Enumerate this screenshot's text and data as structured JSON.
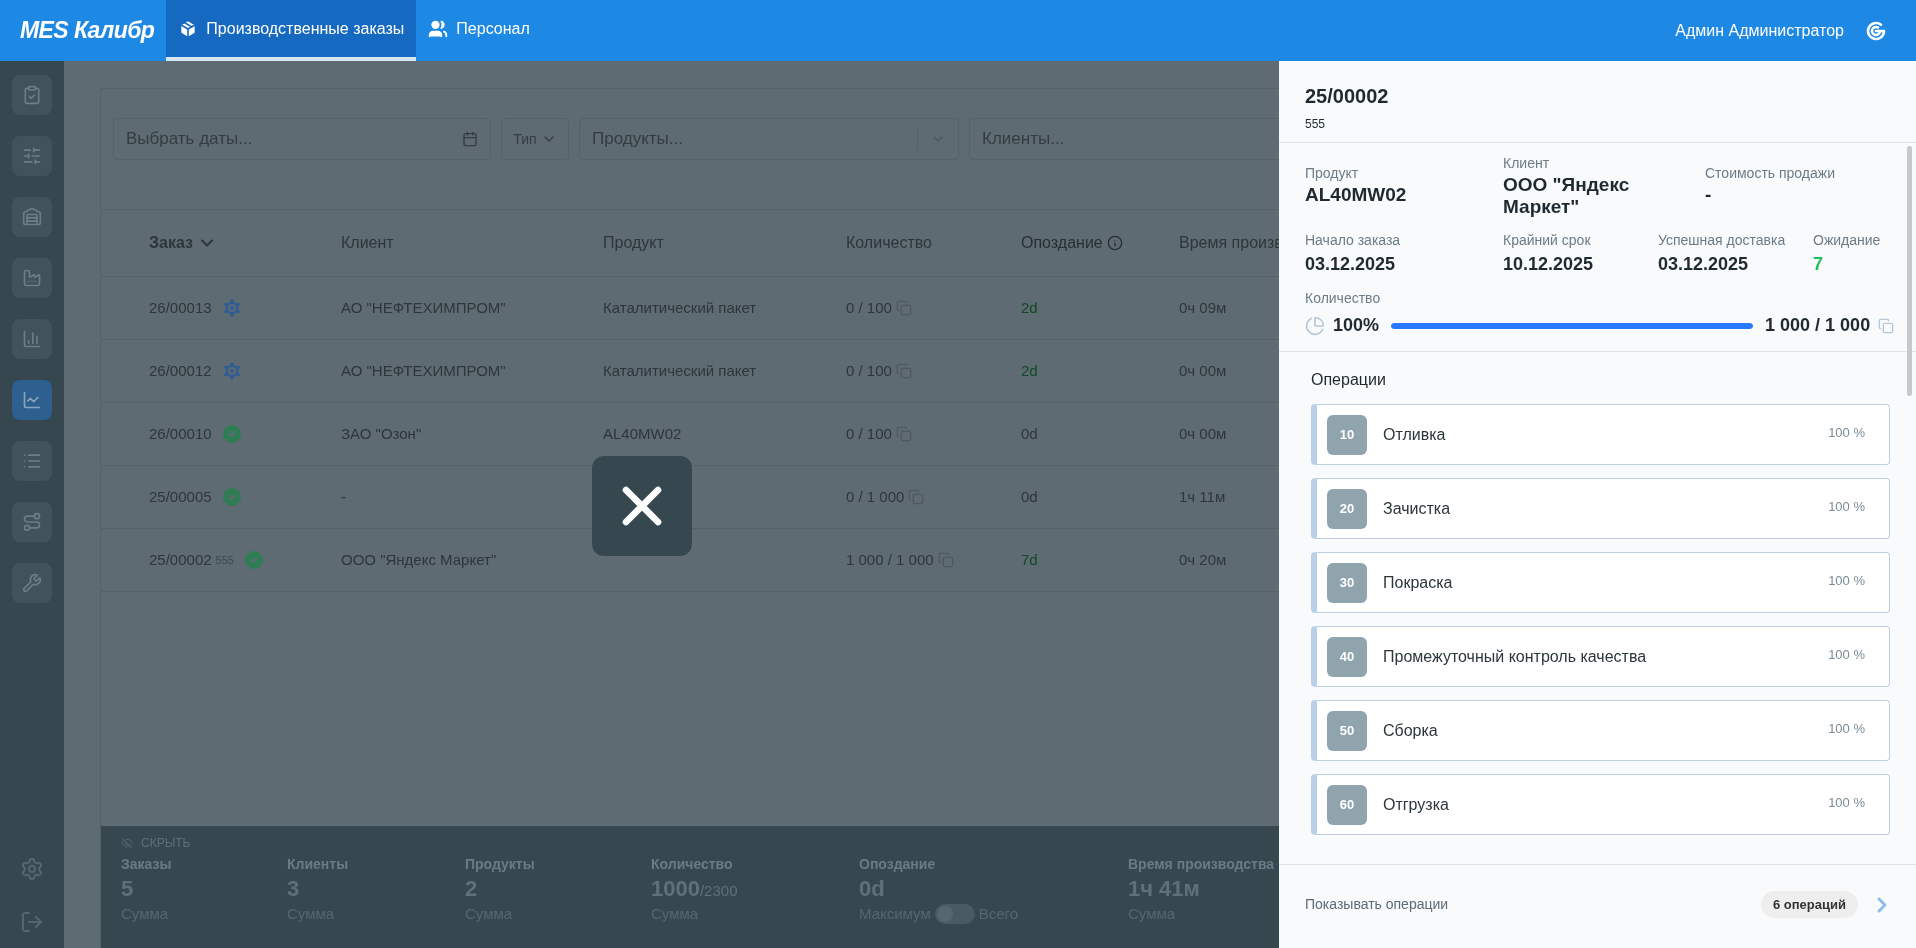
{
  "topbar": {
    "logo": "MES Калибр",
    "nav": [
      {
        "label": "Производственные заказы",
        "kind": "box",
        "selected": true
      },
      {
        "label": "Персонал",
        "kind": "people",
        "selected": false
      }
    ],
    "user": "Админ Администратор"
  },
  "sidebar": {
    "items": [
      {
        "selected": false
      },
      {
        "selected": false
      },
      {
        "selected": false
      },
      {
        "selected": false
      },
      {
        "selected": false
      },
      {
        "selected": true
      },
      {
        "selected": false
      },
      {
        "selected": false
      },
      {
        "selected": false
      }
    ]
  },
  "filters": {
    "dates_placeholder": "Выбрать даты...",
    "type": "Тип",
    "products_placeholder": "Продукты...",
    "clients_placeholder": "Клиенты..."
  },
  "table": {
    "columns": [
      {
        "label": "Заказ",
        "sorted": true,
        "info": false
      },
      {
        "label": "Клиент",
        "sorted": false,
        "info": false
      },
      {
        "label": "Продукт",
        "sorted": false,
        "info": false
      },
      {
        "label": "Количество",
        "sorted": false,
        "info": false
      },
      {
        "label": "Опоздание",
        "sorted": false,
        "info": true
      },
      {
        "label": "Время произв",
        "sorted": false,
        "info": false
      }
    ],
    "rows": [
      {
        "order": "26/00013",
        "kind": "in_progress",
        "client": "АО \"НЕФТЕХИМПРОМ\"",
        "product": "Каталитический пакет",
        "quantity": "0 / 100",
        "delay": "2d",
        "delay_late": true,
        "time": "0ч 09м"
      },
      {
        "order": "26/00012",
        "kind": "in_progress",
        "client": "АО \"НЕФТЕХИМПРОМ\"",
        "product": "Каталитический пакет",
        "quantity": "0 / 100",
        "delay": "2d",
        "delay_late": true,
        "time": "0ч 00м"
      },
      {
        "order": "26/00010",
        "kind": "done",
        "client": "ЗАО \"Озон\"",
        "product": "AL40MW02",
        "quantity": "0 / 100",
        "delay": "0d",
        "delay_late": false,
        "time": "0ч 00м"
      },
      {
        "order": "25/00005",
        "kind": "done",
        "client": "-",
        "quantity": "0 / 1 000",
        "delay": "0d",
        "delay_late": false,
        "time": "1ч 11м"
      },
      {
        "order": "25/00002",
        "note": "555",
        "kind": "done",
        "client": "ООО \"Яндекс Маркет\"",
        "quantity": "1 000 / 1 000",
        "delay": "7d",
        "delay_late": true,
        "time": "0ч 20м"
      }
    ]
  },
  "summary": {
    "hide_label": "СКРЫТЬ",
    "stats": [
      {
        "label": "Заказы",
        "value": "5",
        "sub": "Сумма"
      },
      {
        "label": "Клиенты",
        "value": "3",
        "sub": "Сумма"
      },
      {
        "label": "Продукты",
        "value": "2",
        "sub": "Сумма"
      },
      {
        "label": "Количество",
        "value": "1000",
        "total": "/2300",
        "sub": "Сумма"
      },
      {
        "label": "Опоздание",
        "value": "0d",
        "toggle": {
          "left": "Максимум",
          "right": "Всего",
          "on": false
        }
      },
      {
        "label": "Время производства",
        "value": "1ч 41м",
        "sub": "Сумма"
      }
    ]
  },
  "panel": {
    "order": "25/00002",
    "note": "555",
    "fields_top": [
      {
        "label": "Продукт",
        "value": "AL40MW02"
      },
      {
        "label": "Клиент",
        "value": "ООО \"Яндекс Маркет\""
      },
      {
        "label": "Стоимость продажи",
        "value": "-"
      }
    ],
    "fields_dates": [
      {
        "label": "Начало заказа",
        "value": "03.12.2025",
        "highlight": false
      },
      {
        "label": "Крайний срок",
        "value": "10.12.2025",
        "highlight": false
      },
      {
        "label": "Успешная доставка",
        "value": "03.12.2025",
        "highlight": false
      },
      {
        "label": "Ожидание",
        "value": "7",
        "highlight": true
      }
    ],
    "quantity": {
      "label": "Количество",
      "percent": "100%",
      "level": 1,
      "reading": "1 000 / 1 000"
    },
    "operations_title": "Операции",
    "operations": [
      {
        "number": "10",
        "name": "Отливка",
        "percent": "100 %"
      },
      {
        "number": "20",
        "name": "Зачистка",
        "percent": "100 %"
      },
      {
        "number": "30",
        "name": "Покраска",
        "percent": "100 %"
      },
      {
        "number": "40",
        "name": "Промежуточный контроль качества",
        "percent": "100 %"
      },
      {
        "number": "50",
        "name": "Сборка",
        "percent": "100 %"
      },
      {
        "number": "60",
        "name": "Отгрузка",
        "percent": "100 %"
      }
    ],
    "footer": {
      "label": "Показывать операции",
      "count": "6 операций"
    }
  }
}
